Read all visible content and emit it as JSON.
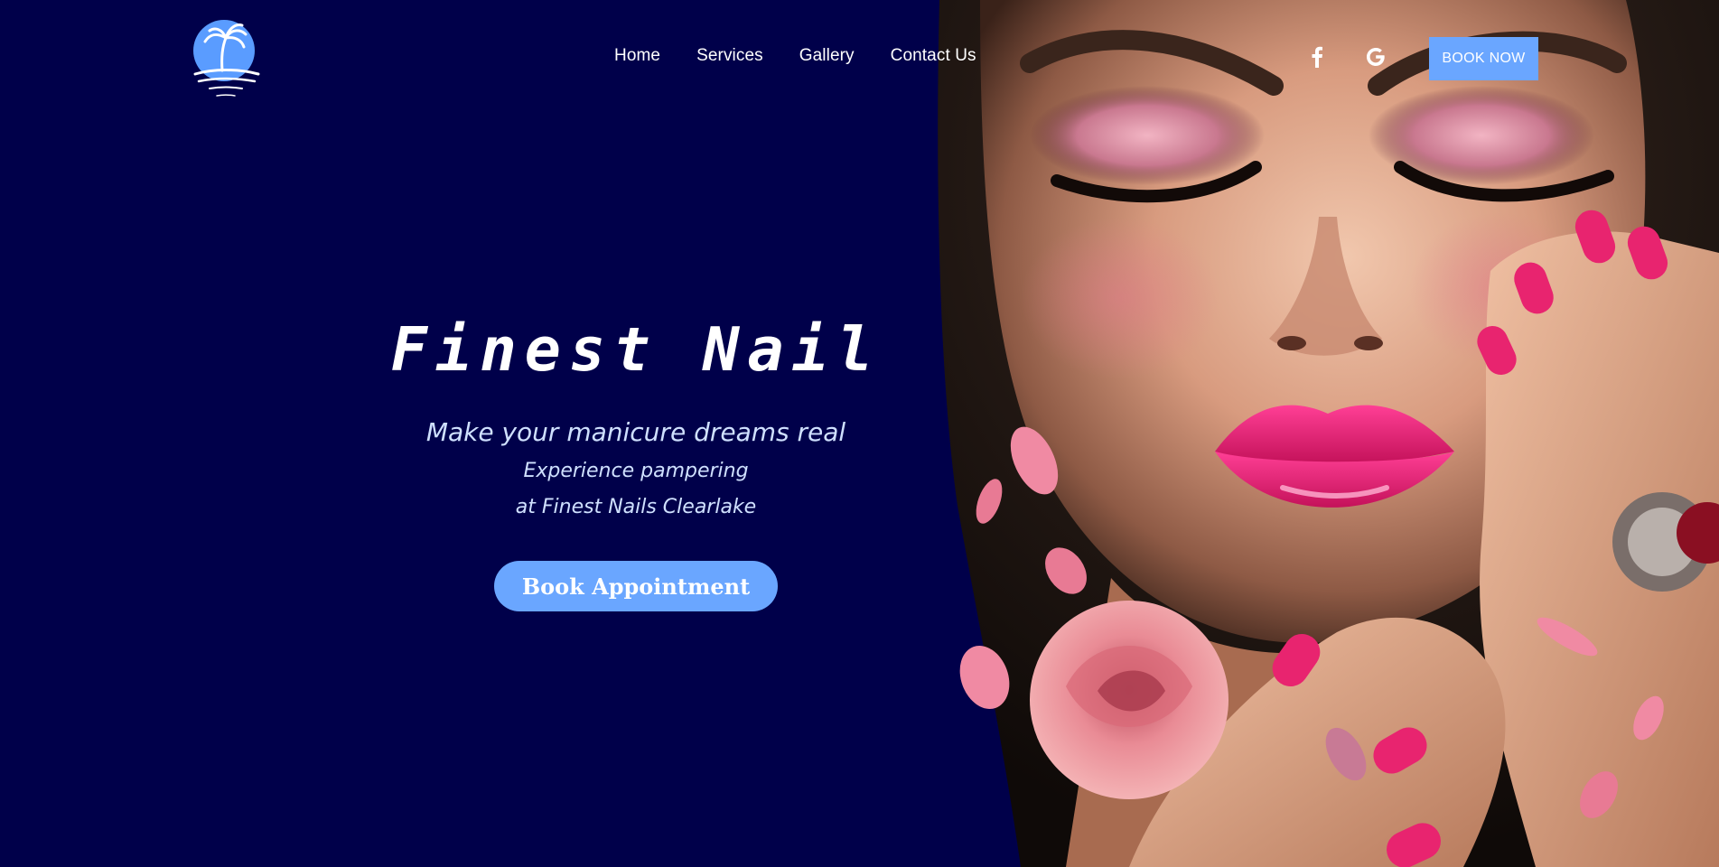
{
  "header": {
    "nav": [
      "Home",
      "Services",
      "Gallery",
      "Contact Us"
    ],
    "social_icons": [
      "facebook-icon",
      "google-icon"
    ],
    "book_now_label": "BOOK NOW"
  },
  "hero": {
    "title": "Finest Nail",
    "tagline_1": "Make your manicure dreams real",
    "tagline_2": "Experience pampering",
    "tagline_3": "at Finest Nails Clearlake",
    "cta_label": "Book Appointment"
  },
  "colors": {
    "background": "#00004a",
    "accent": "#6aa6ff",
    "text": "#ffffff",
    "tagline": "#cfe0ff",
    "nail_pink": "#e8246f"
  }
}
